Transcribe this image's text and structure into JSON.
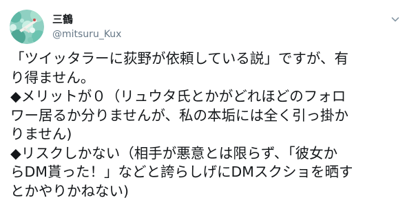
{
  "user": {
    "display_name": "三鶴",
    "handle": "@mitsuru_Kux",
    "avatar": "avatar-image"
  },
  "menu": {
    "icon": "chevron-down-icon"
  },
  "tweet": {
    "lines": [
      "「ツイッタラーに荻野が依頼している説」ですが、有",
      "り得ません。",
      "◆メリットが０（リュウタ氏とかがどれほどのフォロ",
      "ワー居るか分りませんが、私の本垢には全く引っ掛か",
      "りません)",
      "◆リスクしかない（相手が悪意とは限らず、「彼女か",
      "らDM貰った！」などと誇らしげにDMスクショを晒す",
      "とかやりかねない)"
    ]
  },
  "colors": {
    "text": "#14171a",
    "secondary": "#657786",
    "background": "#ffffff"
  }
}
